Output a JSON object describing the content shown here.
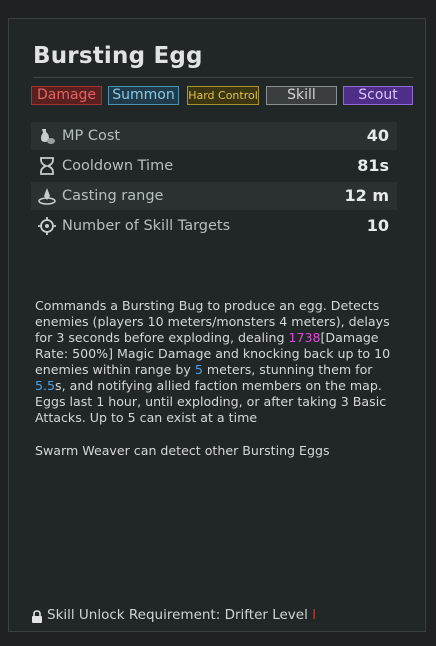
{
  "skill": {
    "title": "Bursting Egg"
  },
  "tags": [
    {
      "label": "Damage"
    },
    {
      "label": "Summon"
    },
    {
      "label": "Hard Control"
    },
    {
      "label": "Skill"
    },
    {
      "label": "Scout"
    }
  ],
  "stats": [
    {
      "label": "MP Cost",
      "value": "40",
      "icon": "potion-icon"
    },
    {
      "label": "Cooldown Time",
      "value": "81s",
      "icon": "hourglass-icon"
    },
    {
      "label": "Casting range",
      "value": "12 m",
      "icon": "range-icon"
    },
    {
      "label": "Number of Skill Targets",
      "value": "10",
      "icon": "target-icon"
    }
  ],
  "description": {
    "p1": "Commands a Bursting Bug to produce an egg. Detects enemies (players 10 meters/monsters 4 meters), delays for 3 seconds before exploding, dealing ",
    "damage_value": "1738",
    "p2": "[Damage Rate: 500%] Magic Damage and knocking back up to 10 enemies within range by ",
    "knockback_value": "5",
    "p3": " meters, stunning them for ",
    "stun_value": "5.5",
    "p4": "s, and notifying allied faction members on the map. Eggs last 1 hour, until exploding, or after taking 3 Basic Attacks. Up to 5 can exist at a time",
    "note": "Swarm Weaver can detect other Bursting Eggs"
  },
  "unlock": {
    "text": "Skill Unlock Requirement: Drifter Level ",
    "level": "I"
  },
  "colors": {
    "damage_highlight": "#e04ad8",
    "value_highlight": "#4fa0e8",
    "scout_tag": "#8f6ad0",
    "damage_tag": "#a83232"
  }
}
